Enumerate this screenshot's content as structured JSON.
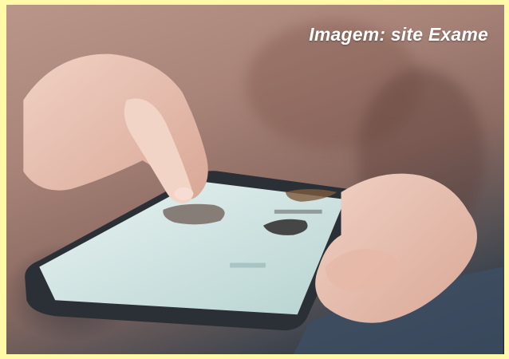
{
  "image": {
    "caption": "Imagem: site Exame",
    "border_color": "#fff9a8",
    "subject": "hand-touching-smartphone-screen"
  }
}
